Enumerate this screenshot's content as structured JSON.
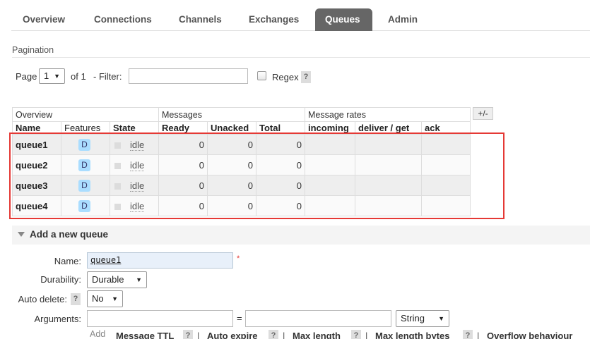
{
  "tabs": [
    "Overview",
    "Connections",
    "Channels",
    "Exchanges",
    "Queues",
    "Admin"
  ],
  "active_tab": "Queues",
  "pagination": {
    "title": "Pagination",
    "page_label": "Page",
    "page_value": "1",
    "of_label": "of 1",
    "filter_label": "- Filter:",
    "filter_value": "",
    "regex_label": "Regex",
    "help": "?"
  },
  "table": {
    "groups": [
      "Overview",
      "Messages",
      "Message rates"
    ],
    "plus_minus": "+/-",
    "columns": [
      "Name",
      "Features",
      "State",
      "Ready",
      "Unacked",
      "Total",
      "incoming",
      "deliver / get",
      "ack"
    ],
    "rows": [
      {
        "name": "queue1",
        "feature": "D",
        "state": "idle",
        "ready": "0",
        "unacked": "0",
        "total": "0"
      },
      {
        "name": "queue2",
        "feature": "D",
        "state": "idle",
        "ready": "0",
        "unacked": "0",
        "total": "0"
      },
      {
        "name": "queue3",
        "feature": "D",
        "state": "idle",
        "ready": "0",
        "unacked": "0",
        "total": "0"
      },
      {
        "name": "queue4",
        "feature": "D",
        "state": "idle",
        "ready": "0",
        "unacked": "0",
        "total": "0"
      }
    ]
  },
  "add_queue": {
    "title": "Add a new queue",
    "name_label": "Name:",
    "name_value": "queue1",
    "required_mark": "*",
    "durability_label": "Durability:",
    "durability_value": "Durable",
    "auto_delete_label": "Auto delete:",
    "auto_delete_value": "No",
    "arguments_label": "Arguments:",
    "arg_key": "",
    "equals": "=",
    "arg_value": "",
    "arg_type": "String",
    "add_label": "Add",
    "arg_links": [
      "Message TTL",
      "Auto expire",
      "Max length",
      "Max length bytes",
      "Overflow behaviour"
    ],
    "help": "?",
    "separator": "|"
  },
  "colors": {
    "active_tab_bg": "#666666",
    "feature_badge_bg": "#aaddff",
    "highlight_border": "#e53935"
  }
}
